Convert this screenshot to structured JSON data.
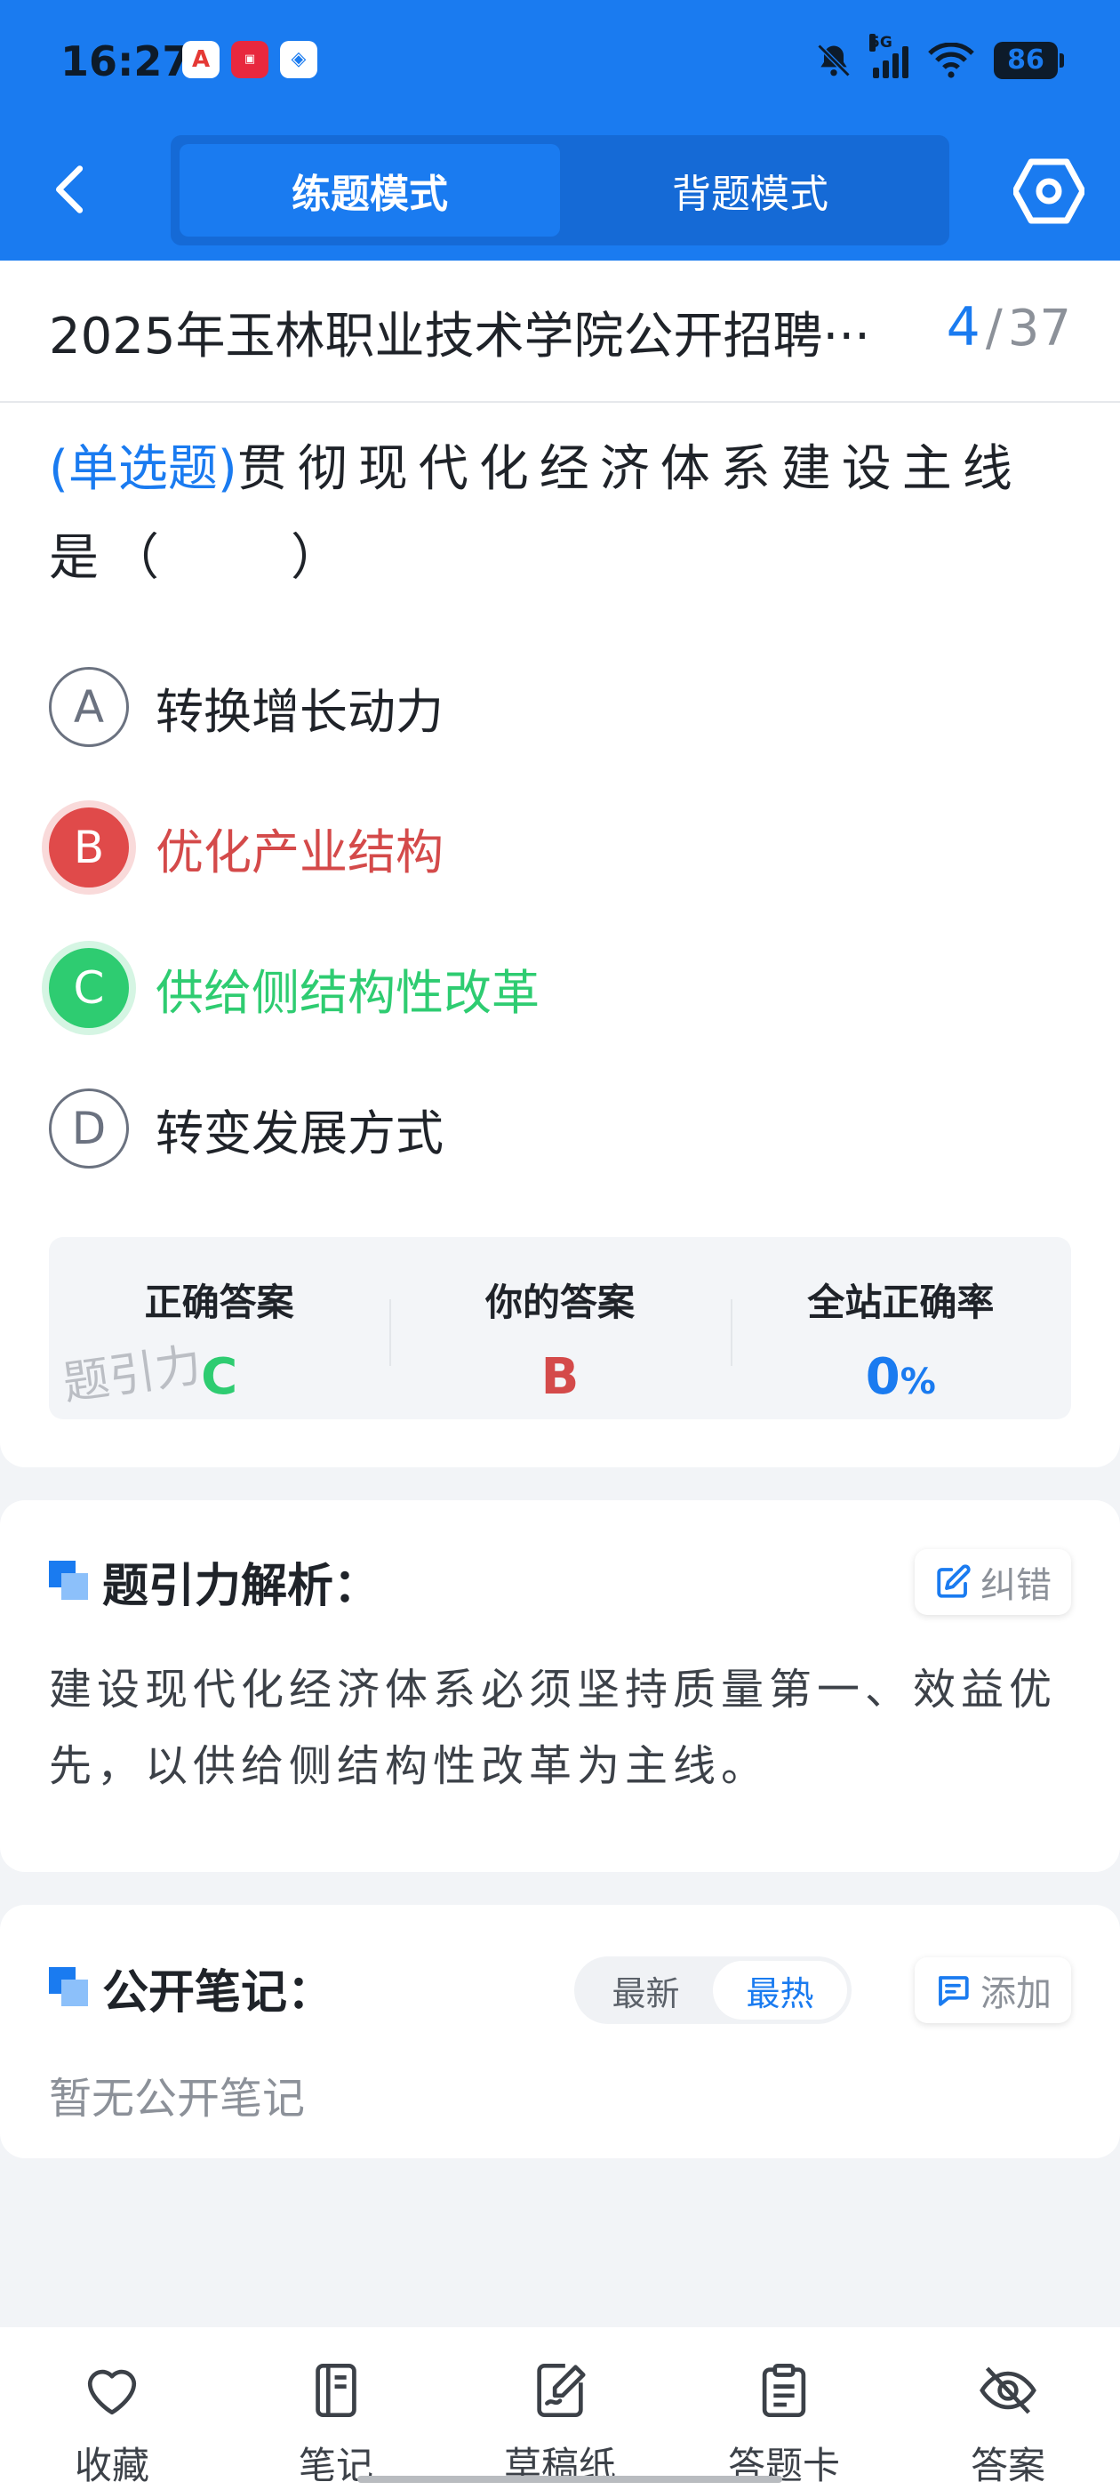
{
  "status_bar": {
    "time": "16:27",
    "network": "5G",
    "battery": "86",
    "app_icons": [
      "app-a-icon",
      "xiaohongshu-icon",
      "shield-app-icon"
    ]
  },
  "header": {
    "tabs": [
      {
        "label": "练题模式",
        "active": true
      },
      {
        "label": "背题模式",
        "active": false
      }
    ]
  },
  "exam": {
    "title": "2025年玉林职业技术学院公开招聘···",
    "current": "4",
    "separator": "/",
    "total": "37"
  },
  "question": {
    "type_label": "(单选题)",
    "text": "贯彻现代化经济体系建设主线是（　　）",
    "options": [
      {
        "letter": "A",
        "text": "转换增长动力",
        "state": "normal"
      },
      {
        "letter": "B",
        "text": "优化产业结构",
        "state": "wrong"
      },
      {
        "letter": "C",
        "text": "供给侧结构性改革",
        "state": "right"
      },
      {
        "letter": "D",
        "text": "转变发展方式",
        "state": "normal"
      }
    ]
  },
  "answer_panel": {
    "correct_label": "正确答案",
    "correct_value": "C",
    "yours_label": "你的答案",
    "yours_value": "B",
    "rate_label": "全站正确率",
    "rate_value": "0",
    "rate_unit": "%",
    "watermark": "题引力"
  },
  "analysis": {
    "title": "题引力解析：",
    "report_label": "纠错",
    "text": "建设现代化经济体系必须坚持质量第一、效益优先，以供给侧结构性改革为主线。"
  },
  "notes": {
    "title": "公开笔记：",
    "sort_tabs": [
      {
        "label": "最新",
        "active": false
      },
      {
        "label": "最热",
        "active": true
      }
    ],
    "add_label": "添加",
    "empty_text": "暂无公开笔记"
  },
  "bottom_nav": [
    {
      "label": "收藏",
      "icon": "heart-icon"
    },
    {
      "label": "笔记",
      "icon": "notebook-icon"
    },
    {
      "label": "草稿纸",
      "icon": "draft-paper-icon"
    },
    {
      "label": "答题卡",
      "icon": "answer-sheet-icon"
    },
    {
      "label": "答案",
      "icon": "eye-off-icon"
    }
  ],
  "colors": {
    "primary": "#1a7bf0",
    "wrong": "#e04a4a",
    "right": "#2ecc71"
  }
}
